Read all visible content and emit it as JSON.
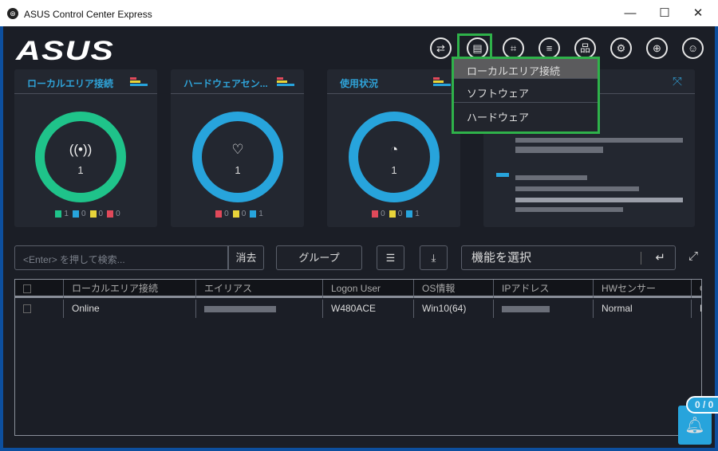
{
  "window": {
    "title": "ASUS Control Center Express",
    "min": "—",
    "max": "☐",
    "close": "✕"
  },
  "brand": "ASUS",
  "toolbar": [
    {
      "icon": "remote-icon",
      "g": "⇄"
    },
    {
      "icon": "report-icon",
      "g": "▤"
    },
    {
      "icon": "scan-icon",
      "g": "⌗"
    },
    {
      "icon": "list-icon",
      "g": "≡"
    },
    {
      "icon": "network-icon",
      "g": "品"
    },
    {
      "icon": "gear-icon",
      "g": "⚙"
    },
    {
      "icon": "globe-icon",
      "g": "⊕"
    },
    {
      "icon": "user-icon",
      "g": "☺"
    }
  ],
  "dropdown": [
    "ローカルエリア接続",
    "ソフトウェア",
    "ハードウェア"
  ],
  "cards": [
    {
      "title": "ローカルエリア接続",
      "icon": "((•))",
      "count": "1",
      "legend": [
        {
          "c": "#1fc38a",
          "v": "1"
        },
        {
          "c": "#27a4dc",
          "v": "0"
        },
        {
          "c": "#e8d43a",
          "v": "0"
        },
        {
          "c": "#e0495a",
          "v": "0"
        }
      ]
    },
    {
      "title": "ハードウェアセン...",
      "icon": "♡",
      "count": "1",
      "legend": [
        {
          "c": "#e0495a",
          "v": "0"
        },
        {
          "c": "#e8d43a",
          "v": "0"
        },
        {
          "c": "#27a4dc",
          "v": "1"
        }
      ]
    },
    {
      "title": "使用状況",
      "icon": "◔",
      "count": "1",
      "legend": [
        {
          "c": "#e0495a",
          "v": "0"
        },
        {
          "c": "#e8d43a",
          "v": "0"
        },
        {
          "c": "#27a4dc",
          "v": "1"
        }
      ]
    }
  ],
  "search": {
    "placeholder": "<Enter> を押して検索...",
    "clear": "消去"
  },
  "group": "グループ",
  "function_select": "機能を選択",
  "table": {
    "headers": [
      "",
      "ローカルエリア接続",
      "エイリアス",
      "Logon User",
      "OS情報",
      "IPアドレス",
      "HWセンサー",
      "Ó"
    ],
    "rows": [
      [
        "",
        "Online",
        "",
        "W480ACE",
        "Win10(64)",
        "",
        "Normal",
        "N"
      ]
    ]
  },
  "notifications": "0 / 0"
}
